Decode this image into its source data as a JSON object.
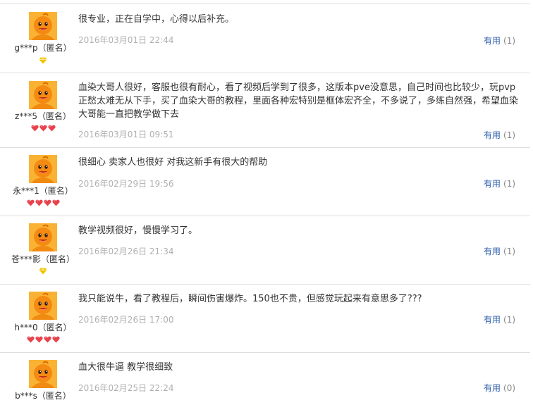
{
  "reviews": [
    {
      "text": "很专业，正在自学中，心得以后补充。",
      "date": "2016年03月01日 22:44",
      "user": "g***p（匿名）",
      "badge": {
        "type": "diamond",
        "count": 1
      },
      "useful_label": "有用",
      "useful_count": "(1)"
    },
    {
      "text": "血染大哥人很好，客服也很有耐心，看了视频后学到了很多，这版本pve没意思，自己时间也比较少，玩pvp正愁太难无从下手，买了血染大哥的教程，里面各种宏特别是框体宏齐全，不多说了，多练自然强，希望血染大哥能一直把教学做下去",
      "date": "2016年03月01日 09:51",
      "user": "z***5（匿名）",
      "badge": {
        "type": "heart",
        "count": 3
      },
      "useful_label": "有用",
      "useful_count": "(1)"
    },
    {
      "text": "很细心 卖家人也很好 对我这新手有很大的帮助",
      "date": "2016年02月29日 19:56",
      "user": "永***1（匿名）",
      "badge": {
        "type": "heart",
        "count": 4
      },
      "useful_label": "有用",
      "useful_count": "(1)"
    },
    {
      "text": "教学视频很好，慢慢学习了。",
      "date": "2016年02月26日 21:34",
      "user": "苍***影（匿名）",
      "badge": {
        "type": "diamond",
        "count": 1
      },
      "useful_label": "有用",
      "useful_count": "(1)"
    },
    {
      "text": "我只能说牛，看了教程后，瞬间伤害爆炸。150也不贵，但感觉玩起来有意思多了???",
      "date": "2016年02月26日 17:00",
      "user": "h***0（匿名）",
      "badge": {
        "type": "heart",
        "count": 4
      },
      "useful_label": "有用",
      "useful_count": "(1)"
    },
    {
      "text": "血大很牛逼 教学很细致",
      "date": "2016年02月25日 22:24",
      "user": "b***s（匿名）",
      "badge": {
        "type": "none",
        "count": 0
      },
      "useful_label": "有用",
      "useful_count": "(0)"
    }
  ],
  "colors": {
    "link": "#2a5caa",
    "date": "#b0b0b0",
    "separator": "#dedede",
    "heart_badge": "#e8424c",
    "diamond_badge": "#f2c200"
  },
  "icons": {
    "avatar": "taobao-orange-doll-avatar-icon",
    "heart": "red-heart-level-icon",
    "diamond": "yellow-diamond-level-icon"
  }
}
